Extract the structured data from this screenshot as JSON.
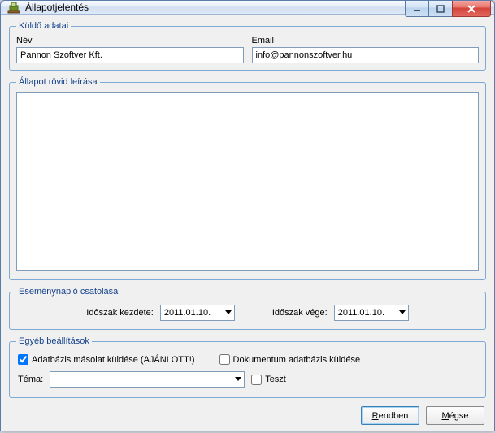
{
  "window": {
    "title": "Állapotjelentés"
  },
  "sender": {
    "legend": "Küldő adatai",
    "name_label": "Név",
    "name_value": "Pannon Szoftver Kft.",
    "email_label": "Email",
    "email_value": "info@pannonszoftver.hu"
  },
  "desc": {
    "legend": "Állapot rövid leírása",
    "value": ""
  },
  "log": {
    "legend": "Eseménynapló csatolása",
    "start_label": "Időszak kezdete:",
    "start_value": "2011.01.10.",
    "end_label": "Időszak vége:",
    "end_value": "2011.01.10."
  },
  "other": {
    "legend": "Egyéb beállítások",
    "db_copy_label": "Adatbázis másolat küldése (AJÁNLOTT!)",
    "db_copy_checked": true,
    "doc_db_label": "Dokumentum adatbázis küldése",
    "doc_db_checked": false,
    "theme_label": "Téma:",
    "theme_value": "",
    "test_label": "Teszt",
    "test_checked": false
  },
  "buttons": {
    "ok_prefix": "R",
    "ok_rest": "endben",
    "cancel_prefix": "M",
    "cancel_rest": "égse"
  }
}
